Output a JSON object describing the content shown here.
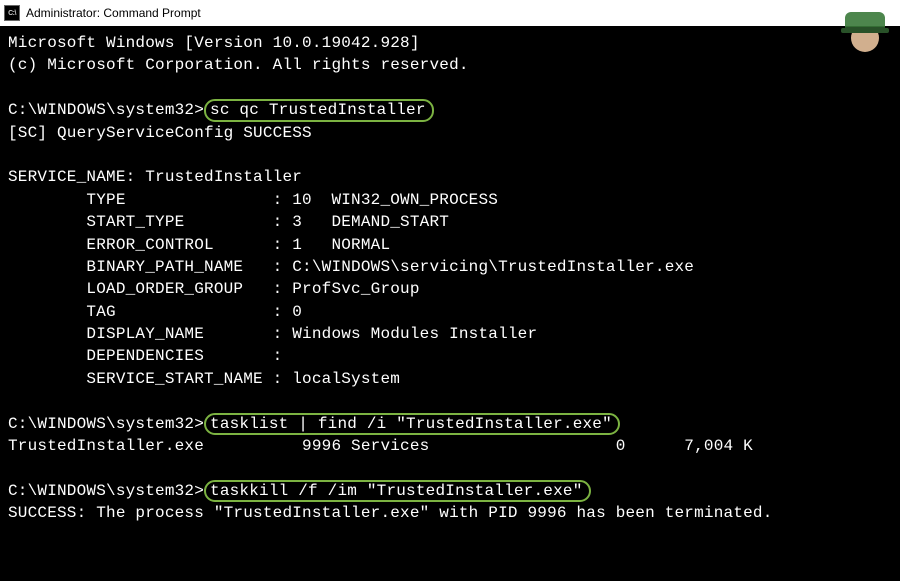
{
  "titlebar": {
    "icon_text": "C:\\",
    "title": "Administrator: Command Prompt"
  },
  "terminal": {
    "banner1": "Microsoft Windows [Version 10.0.19042.928]",
    "banner2": "(c) Microsoft Corporation. All rights reserved.",
    "prompt": "C:\\WINDOWS\\system32>",
    "cmd1": "sc qc TrustedInstaller",
    "sc_result": "[SC] QueryServiceConfig SUCCESS",
    "service_name_line": "SERVICE_NAME: TrustedInstaller",
    "fields": {
      "type": "        TYPE               : 10  WIN32_OWN_PROCESS",
      "start_type": "        START_TYPE         : 3   DEMAND_START",
      "error_control": "        ERROR_CONTROL      : 1   NORMAL",
      "binary_path": "        BINARY_PATH_NAME   : C:\\WINDOWS\\servicing\\TrustedInstaller.exe",
      "load_order": "        LOAD_ORDER_GROUP   : ProfSvc_Group",
      "tag": "        TAG                : 0",
      "display_name": "        DISPLAY_NAME       : Windows Modules Installer",
      "dependencies": "        DEPENDENCIES       :",
      "svc_start_name": "        SERVICE_START_NAME : localSystem"
    },
    "cmd2": "tasklist | find /i \"TrustedInstaller.exe\"",
    "tasklist_row": "TrustedInstaller.exe          9996 Services                   0      7,004 K",
    "cmd3": "taskkill /f /im \"TrustedInstaller.exe\"",
    "kill_result": "SUCCESS: The process \"TrustedInstaller.exe\" with PID 9996 has been terminated."
  }
}
